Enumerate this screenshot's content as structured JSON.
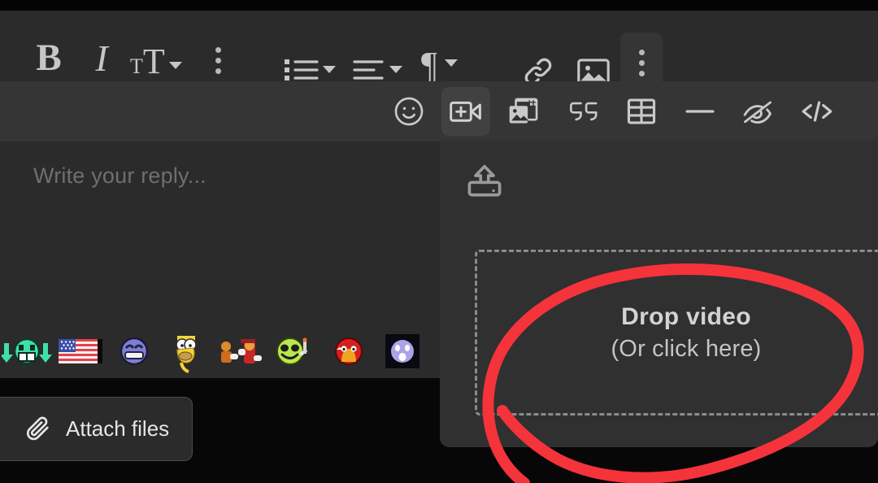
{
  "colors": {
    "toolbar_bg": "#2b2b2b",
    "toolbar_row2_bg": "#353535",
    "panel_bg": "#303030",
    "editor_bg": "#2b2b2b",
    "page_bg": "#070707",
    "icon": "#c9c9c9",
    "placeholder_text": "#6f6f6f",
    "annotation_red": "#f5333a",
    "dropzone_border": "#8b8b8b",
    "active_button_bg": "#414141"
  },
  "toolbar_row1": {
    "buttons": [
      {
        "name": "bold-button",
        "label": "B",
        "icon": "bold-icon"
      },
      {
        "name": "italic-button",
        "label": "I",
        "icon": "italic-icon"
      },
      {
        "name": "text-size-button",
        "label_small": "T",
        "label_big": "T",
        "icon": "text-size-icon",
        "has_caret": true
      },
      {
        "name": "inline-more-button",
        "label": "",
        "icon": "more-vertical-icon"
      },
      {
        "name": "bullet-list-button",
        "label": "",
        "icon": "bullet-list-icon",
        "has_caret": true
      },
      {
        "name": "align-button",
        "label": "",
        "icon": "align-left-icon",
        "has_caret": true
      },
      {
        "name": "paragraph-button",
        "label": "¶",
        "icon": "paragraph-icon",
        "has_caret": true
      },
      {
        "name": "link-button",
        "label": "",
        "icon": "link-icon"
      },
      {
        "name": "image-button",
        "label": "",
        "icon": "image-icon"
      },
      {
        "name": "more-options-button",
        "label": "",
        "icon": "more-vertical-icon",
        "active": true
      }
    ]
  },
  "toolbar_row2": {
    "buttons": [
      {
        "name": "emoji-button",
        "icon": "smiley-icon",
        "active": false
      },
      {
        "name": "insert-video-button",
        "icon": "video-add-icon",
        "active": true
      },
      {
        "name": "gallery-button",
        "icon": "gallery-icon",
        "active": false
      },
      {
        "name": "quote-button",
        "icon": "quote-icon",
        "active": false
      },
      {
        "name": "table-button",
        "icon": "table-icon",
        "active": false
      },
      {
        "name": "horizontal-rule-button",
        "icon": "minus-icon",
        "active": false
      },
      {
        "name": "spoiler-button",
        "icon": "eye-slash-icon",
        "active": false
      },
      {
        "name": "code-button",
        "icon": "code-icon",
        "active": false
      }
    ]
  },
  "editor": {
    "placeholder": "Write your reply...",
    "value": "",
    "emoticons": [
      {
        "name": "emoticon-green-grin-arrows",
        "alt": "green grinning face with down arrows"
      },
      {
        "name": "emoticon-usa-flag",
        "alt": "waving United States flag"
      },
      {
        "name": "emoticon-blue-smile",
        "alt": "blue smiling face"
      },
      {
        "name": "emoticon-homer-simpson",
        "alt": "Homer Simpson"
      },
      {
        "name": "emoticon-boxing-fight",
        "alt": "boxing fight animation"
      },
      {
        "name": "emoticon-green-smoking",
        "alt": "green face smoking"
      },
      {
        "name": "emoticon-red-angry",
        "alt": "red angry face"
      },
      {
        "name": "emoticon-purple-shock",
        "alt": "purple shocked face"
      }
    ]
  },
  "attach": {
    "label": "Attach files",
    "icon": "paperclip-icon"
  },
  "video_panel": {
    "upload_icon": "upload-icon",
    "dropzone": {
      "title": "Drop video",
      "subtitle": "(Or click here)"
    }
  },
  "annotation": {
    "type": "hand-drawn-circle",
    "color": "#f5333a",
    "target": "Drop video (Or click here)"
  }
}
